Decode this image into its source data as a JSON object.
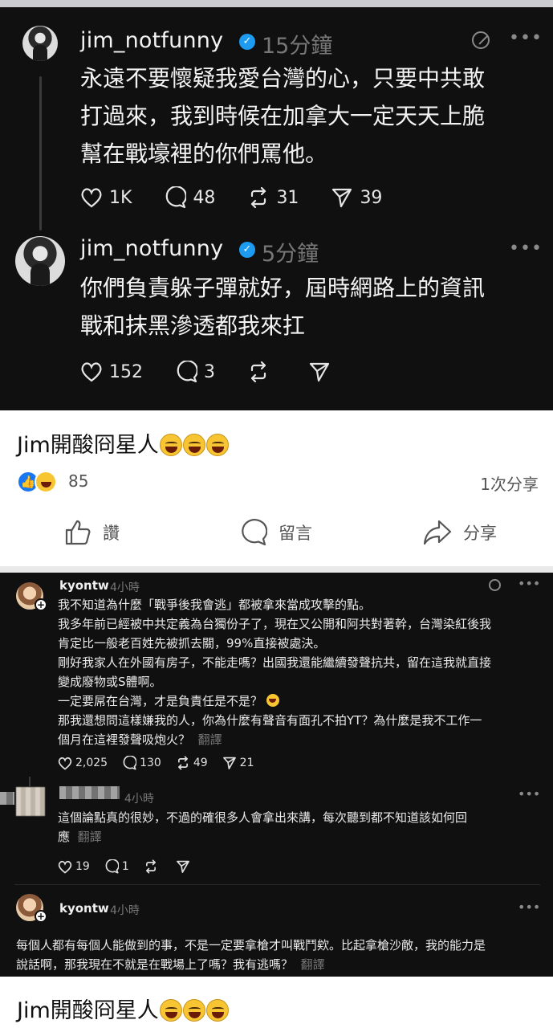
{
  "post1": {
    "username": "jim_notfunny",
    "time": "15分鐘",
    "lines": [
      "永遠不要懷疑我愛台灣的心，只要中共敢",
      "打過來，我到時候在加拿大一定天天上脆",
      "幫在戰壕裡的你們罵他。"
    ],
    "likes": "1K",
    "comments": "48",
    "reposts": "31",
    "shares": "39"
  },
  "post2": {
    "username": "jim_notfunny",
    "time": "5分鐘",
    "lines": [
      "你們負責躲子彈就好，屆時網路上的資訊",
      "戰和抹黑滲透都我來扛"
    ],
    "likes": "152",
    "comments": "3"
  },
  "caption1": "Jim開酸冏星人",
  "fb": {
    "reaction_count": "85",
    "share_count": "1次分享",
    "like_label": "讚",
    "comment_label": "留言",
    "share_label": "分享"
  },
  "reply1": {
    "username": "kyontw",
    "time": "4小時",
    "lines": [
      "我不知道為什麼「戰爭後我會逃」都被拿來當成攻擊的點。",
      "我多年前已經被中共定義為台獨份子了，現在又公開和阿共對著幹，台灣染紅後我",
      "肯定比一般老百姓先被抓去關，99%直接被處決。",
      "剛好我家人在外國有房子，不能走嗎？出國我還能繼續發聲抗共，留在這我就直接",
      "變成廢物或S體啊。",
      "一定要屌在台灣，才是負責任是不是？",
      "那我還想問這樣嫌我的人，你為什麼有聲音有面孔不拍YT？為什麼是我不工作一",
      "個月在這裡發聲吸炮火？"
    ],
    "translate": "翻譯",
    "likes": "2,025",
    "comments": "130",
    "reposts": "49",
    "shares": "21"
  },
  "reply2": {
    "time": "4小時",
    "lines": [
      "這個論點真的很妙，不過的確很多人會拿出來講，每次聽到都不知道該如何回",
      "應"
    ],
    "translate": "翻譯",
    "likes": "19",
    "comments": "1"
  },
  "reply3": {
    "username": "kyontw",
    "time": "4小時",
    "lines": [
      "每個人都有每個人能做到的事，不是一定要拿槍才叫戰鬥欸。比起拿槍沙敵，我的能力是",
      "說話啊，那我現在不就是在戰場上了嗎？我有逃嗎？"
    ],
    "translate": "翻譯"
  },
  "caption2": "Jim開酸冏星人"
}
